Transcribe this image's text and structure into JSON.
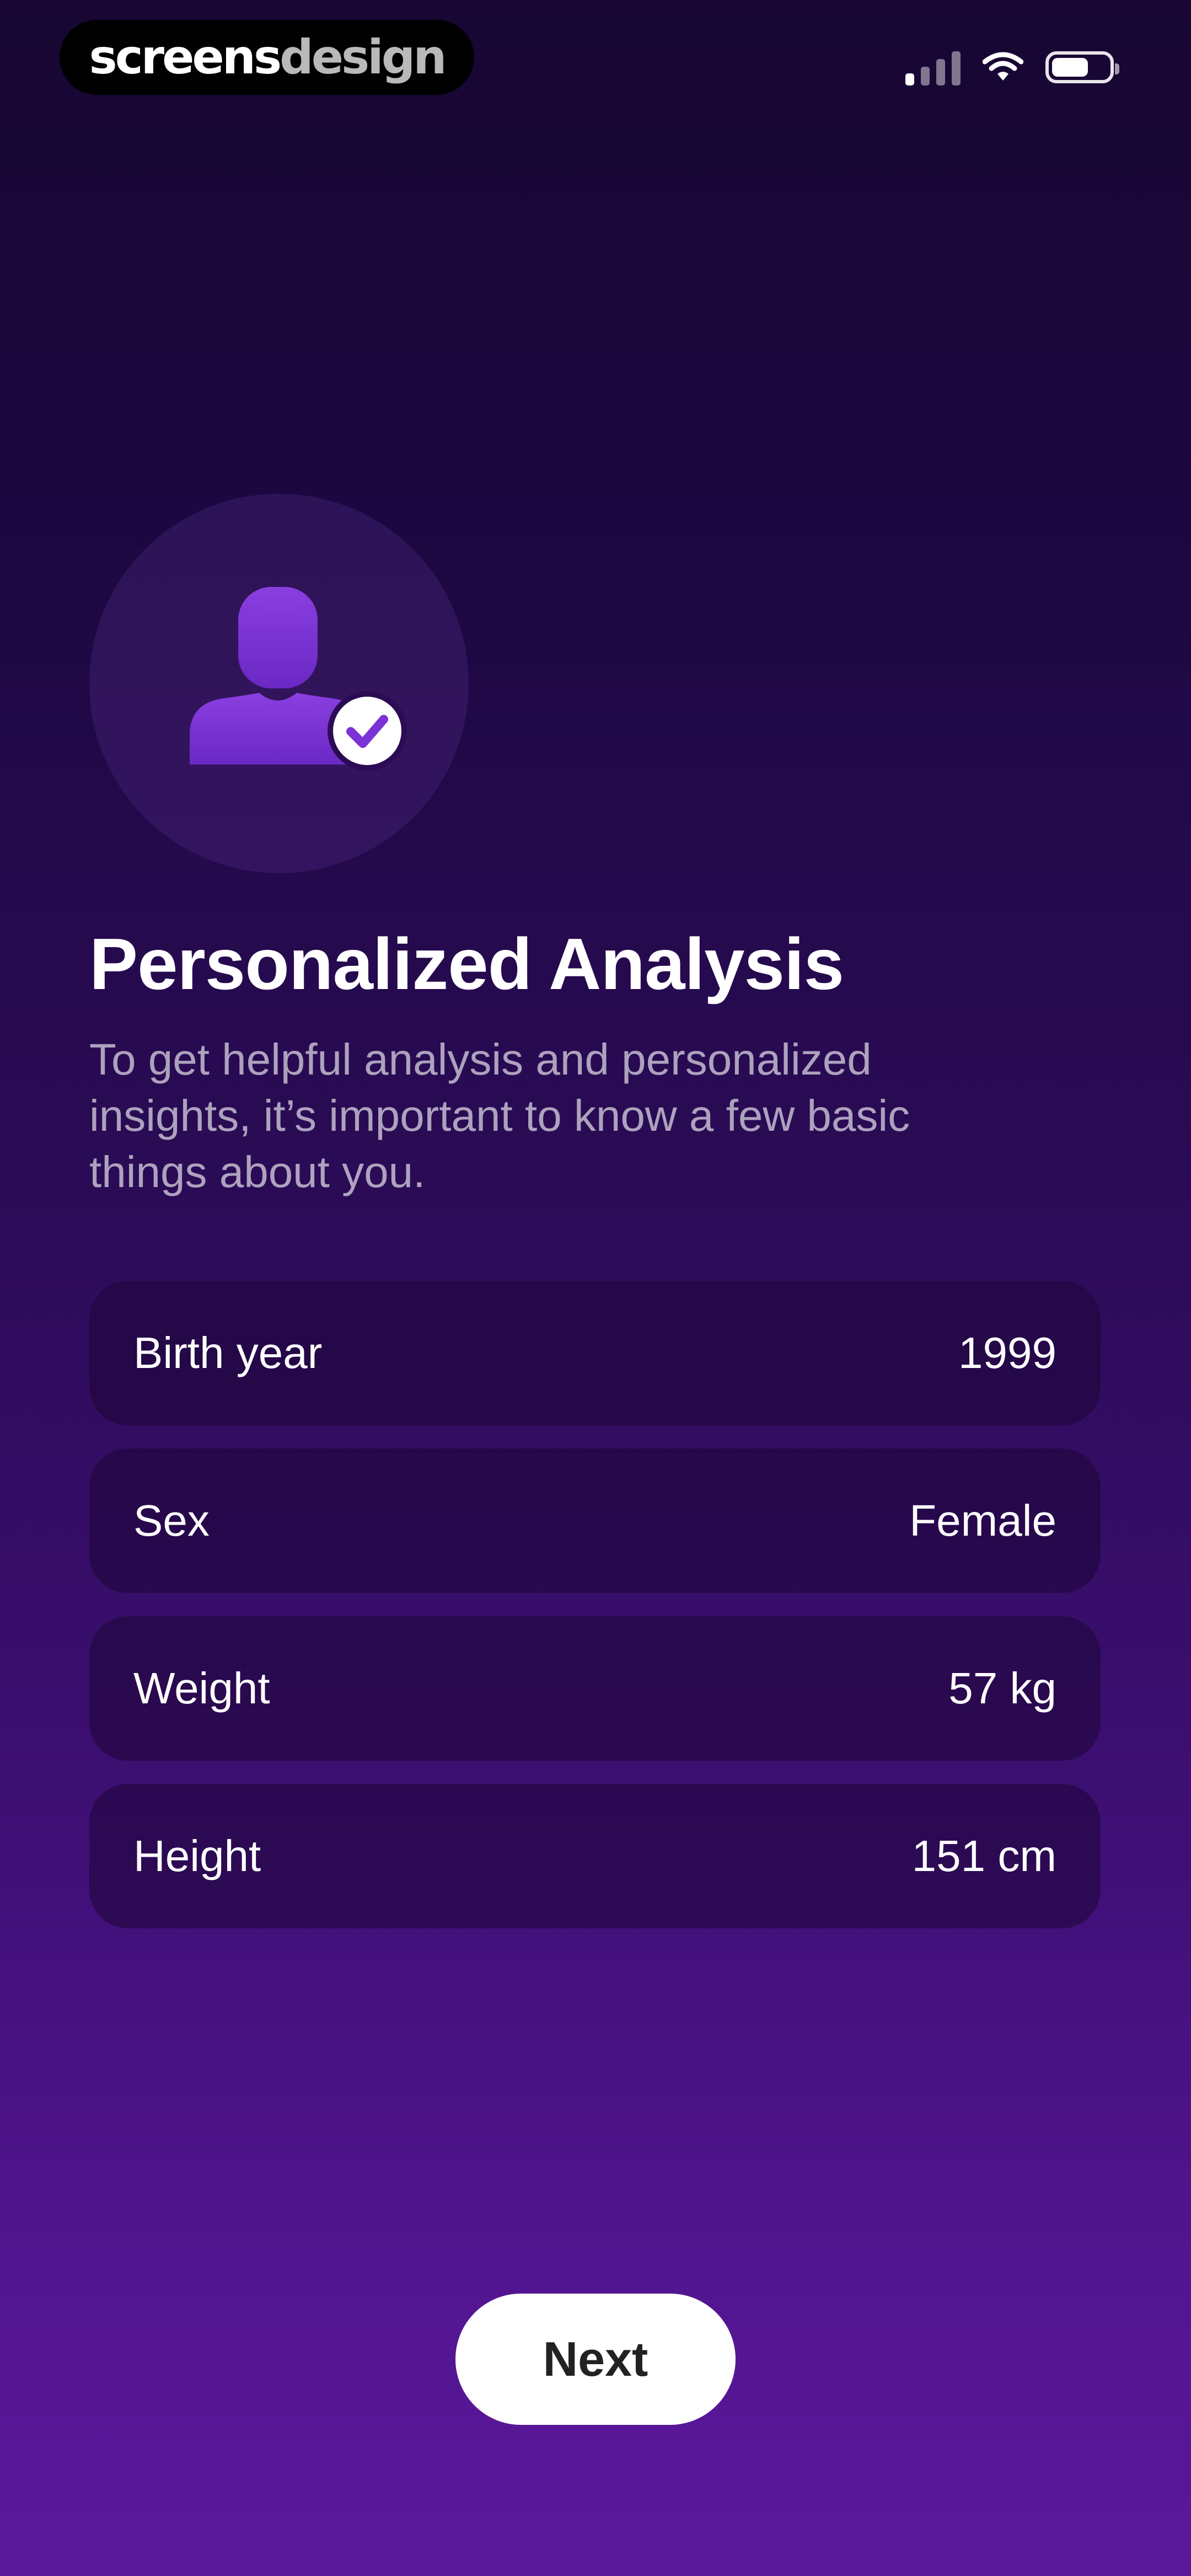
{
  "watermark": {
    "part1": "screens",
    "part2": "design"
  },
  "status_bar": {
    "signal_icon": "cellular-signal-icon",
    "wifi_icon": "wifi-icon",
    "battery_icon": "battery-icon"
  },
  "hero": {
    "icon": "user-verified-icon",
    "accent": "#7b33d6"
  },
  "title": "Personalized Analysis",
  "subtitle": "To get helpful analysis and personalized insights, it’s important to know a few basic things about you.",
  "fields": [
    {
      "label": "Birth year",
      "value": "1999"
    },
    {
      "label": "Sex",
      "value": "Female"
    },
    {
      "label": "Weight",
      "value": "57 kg"
    },
    {
      "label": "Height",
      "value": "151 cm"
    }
  ],
  "next_label": "Next"
}
